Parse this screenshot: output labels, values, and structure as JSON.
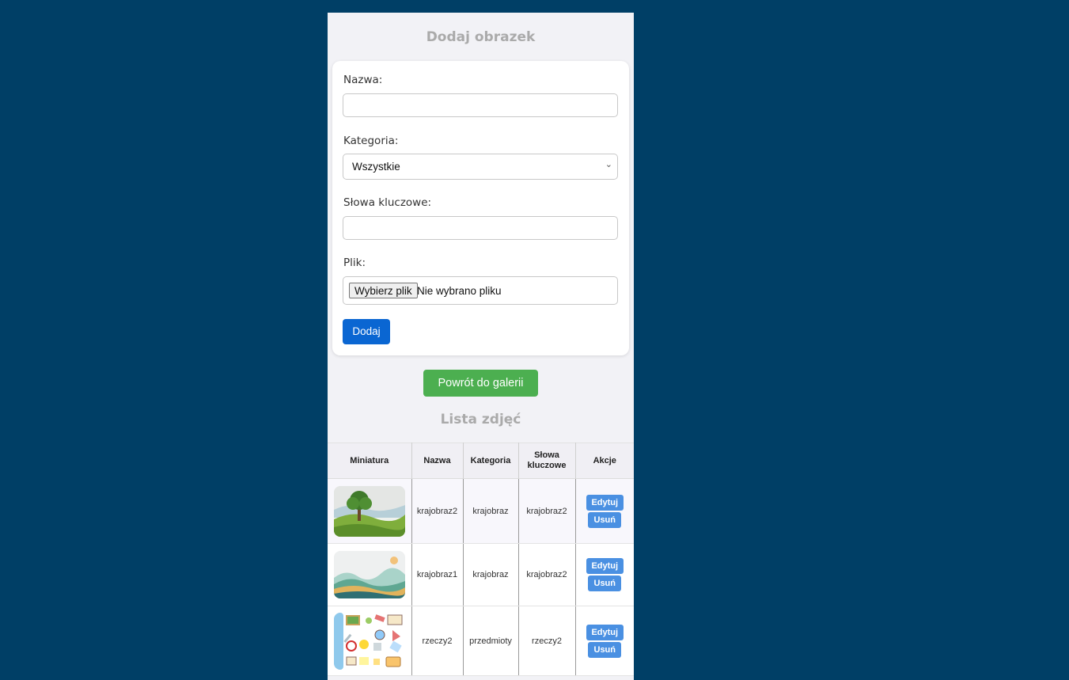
{
  "form": {
    "title": "Dodaj obrazek",
    "name_label": "Nazwa:",
    "name_value": "",
    "category_label": "Kategoria:",
    "category_value": "Wszystkie",
    "keywords_label": "Słowa kluczowe:",
    "keywords_value": "",
    "file_label": "Plik:",
    "file_button": "Wybierz plik",
    "file_status": "Nie wybrano pliku",
    "submit_label": "Dodaj"
  },
  "back_button": "Powrót do galerii",
  "list": {
    "title": "Lista zdjęć",
    "headers": [
      "Miniatura",
      "Nazwa",
      "Kategoria",
      "Słowa kluczowe",
      "Akcje"
    ],
    "rows": [
      {
        "thumb": "landscape-tree-thumbnail",
        "name": "krajobraz2",
        "category": "krajobraz",
        "keywords": "krajobraz2",
        "edit": "Edytuj",
        "delete": "Usuń"
      },
      {
        "thumb": "landscape-hills-thumbnail",
        "name": "krajobraz1",
        "category": "krajobraz",
        "keywords": "krajobraz2",
        "edit": "Edytuj",
        "delete": "Usuń"
      },
      {
        "thumb": "school-items-thumbnail",
        "name": "rzeczy2",
        "category": "przedmioty",
        "keywords": "rzeczy2",
        "edit": "Edytuj",
        "delete": "Usuń"
      }
    ]
  },
  "colors": {
    "page_background": "#003f66",
    "panel_background": "#f2f2f6",
    "submit_button": "#0a66d2",
    "back_button": "#4caf50",
    "action_button": "#4a90e2"
  }
}
